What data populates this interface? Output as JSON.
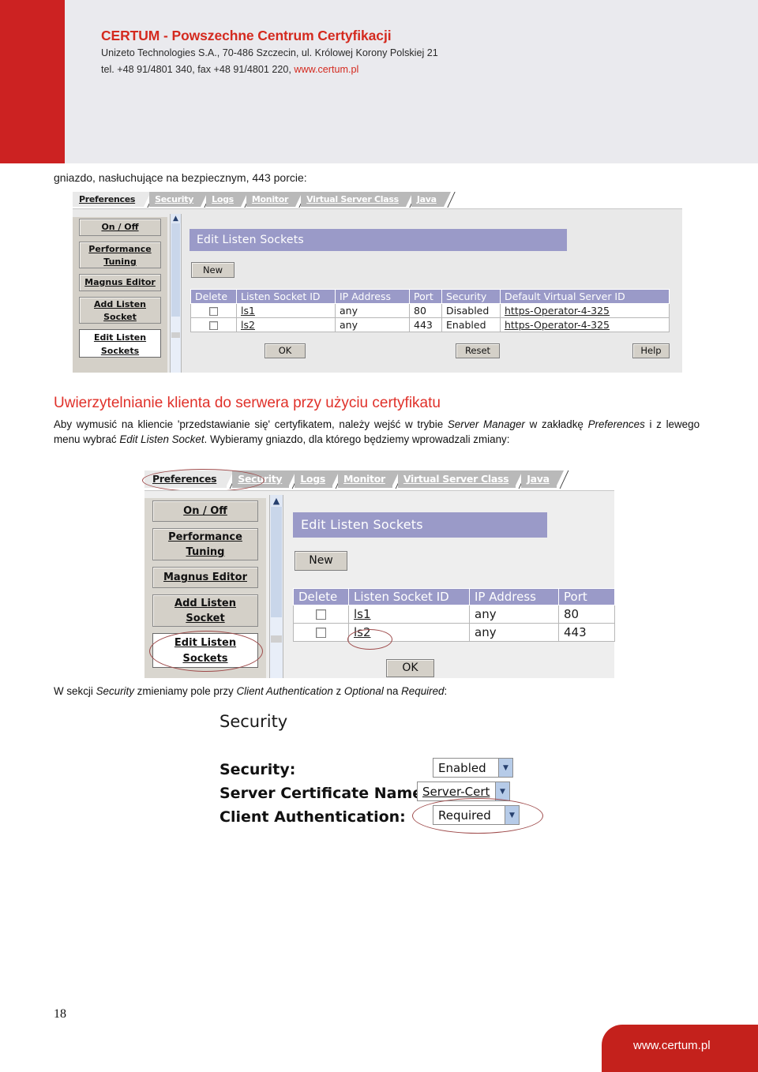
{
  "header": {
    "company_title": "CERTUM - Powszechne Centrum Certyfikacji",
    "address_line": "Unizeto Technologies S.A., 70-486 Szczecin, ul. Królowej Korony Polskiej 21",
    "contact_prefix": "tel. +48 91/4801 340, fax +48 91/4801 220, ",
    "contact_url": "www.certum.pl",
    "accent_red": "#d42a1f",
    "bar_red": "#cc2222",
    "band_bg": "#eaeaee"
  },
  "body": {
    "lead_line": "gniazdo, nasłuchujące na bezpiecznym, 443 porcie:",
    "section_heading": "Uwierzytelnianie klienta do serwera przy użyciu certyfikatu",
    "paragraph_parts": {
      "p1": "Aby wymusić na kliencie 'przedstawianie się' certyfikatem, należy wejść w trybie ",
      "i1": "Server Manager",
      "p2": " w zakładkę ",
      "i2": "Preferences",
      "p3": " i z lewego menu wybrać ",
      "i3": "Edit Listen Socket",
      "p4": ". Wybieramy gniazdo, dla którego będziemy wprowadzali zmiany:"
    },
    "caption_parts": {
      "c1": "W sekcji ",
      "ci1": "Security",
      "c2": " zmieniamy pole przy ",
      "ci2": "Client Authentication",
      "c3": " z ",
      "ci3": "Optional",
      "c4": " na ",
      "ci4": "Required",
      "c5": ":"
    }
  },
  "screenshot1": {
    "tabs": [
      {
        "label": "Preferences",
        "active": true
      },
      {
        "label": "Security",
        "active": false
      },
      {
        "label": "Logs",
        "active": false
      },
      {
        "label": "Monitor",
        "active": false
      },
      {
        "label": "Virtual Server Class",
        "active": false
      },
      {
        "label": "Java",
        "active": false
      }
    ],
    "left_menu": [
      {
        "label": "On / Off",
        "selected": false
      },
      {
        "label": "Performance\nTuning",
        "line1": "Performance",
        "line2": "Tuning",
        "selected": false
      },
      {
        "label": "Magnus Editor",
        "selected": false
      },
      {
        "label": "Add Listen\nSocket",
        "line1": "Add Listen",
        "line2": "Socket",
        "selected": false
      },
      {
        "label": "Edit Listen\nSockets",
        "line1": "Edit Listen",
        "line2": "Sockets",
        "selected": true
      }
    ],
    "panel_title": "Edit Listen Sockets",
    "new_button": "New",
    "table": {
      "columns": [
        "Delete",
        "Listen Socket ID",
        "IP Address",
        "Port",
        "Security",
        "Default Virtual Server ID"
      ],
      "rows": [
        {
          "delete": "",
          "id": "ls1",
          "ip": "any",
          "port": "80",
          "security": "Disabled",
          "vserver": "https-Operator-4-325"
        },
        {
          "delete": "",
          "id": "ls2",
          "ip": "any",
          "port": "443",
          "security": "Enabled",
          "vserver": "https-Operator-4-325"
        }
      ]
    },
    "buttons": {
      "ok": "OK",
      "reset": "Reset",
      "help": "Help"
    },
    "title_bar_color": "#9a9ac8"
  },
  "screenshot2": {
    "tabs": [
      {
        "label": "Preferences",
        "active": true
      },
      {
        "label": "Security",
        "active": false
      },
      {
        "label": "Logs",
        "active": false
      },
      {
        "label": "Monitor",
        "active": false
      },
      {
        "label": "Virtual Server Class",
        "active": false
      },
      {
        "label": "Java",
        "active": false
      }
    ],
    "left_menu": [
      {
        "label": "On / Off"
      },
      {
        "line1": "Performance",
        "line2": "Tuning"
      },
      {
        "label": "Magnus Editor"
      },
      {
        "line1": "Add Listen",
        "line2": "Socket"
      },
      {
        "line1": "Edit Listen",
        "line2": "Sockets"
      }
    ],
    "panel_title": "Edit Listen Sockets",
    "new_button": "New",
    "table": {
      "columns": [
        "Delete",
        "Listen Socket ID",
        "IP Address",
        "Port"
      ],
      "rows": [
        {
          "id": "ls1",
          "ip": "any",
          "port": "80"
        },
        {
          "id": "ls2",
          "ip": "any",
          "port": "443"
        }
      ]
    },
    "ok_button": "OK",
    "annotations": [
      "preferences-tab-circled",
      "ls2-cell-circled",
      "edit-listen-sockets-button-circled"
    ],
    "annotation_color": "#9e4a4a"
  },
  "screenshot3": {
    "heading": "Security",
    "fields": [
      {
        "label": "Security:",
        "value": "Enabled",
        "underlined": false
      },
      {
        "label": "Server Certificate Name:",
        "value": "Server-Cert",
        "underlined": true
      },
      {
        "label": "Client Authentication:",
        "value": "Required",
        "underlined": false
      }
    ],
    "annotation": "client-authentication-circled",
    "annotation_color": "#9e4a4a"
  },
  "footer": {
    "page_number": "18",
    "url": "www.certum.pl",
    "bg": "#c4211c"
  }
}
